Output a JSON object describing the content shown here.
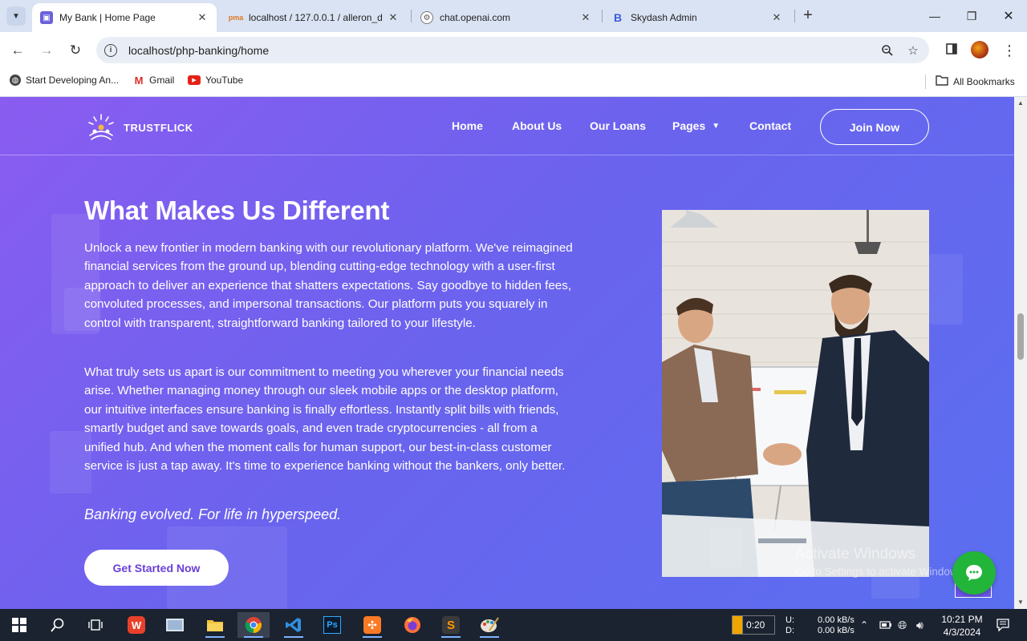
{
  "browser": {
    "tabs": [
      {
        "title": "My Bank | Home Page",
        "favicon": "bank-favicon",
        "active": true
      },
      {
        "title": "localhost / 127.0.0.1 / alleron_d",
        "favicon": "phpmyadmin-favicon",
        "active": false
      },
      {
        "title": "chat.openai.com",
        "favicon": "openai-favicon",
        "active": false
      },
      {
        "title": "Skydash Admin",
        "favicon": "skydash-favicon",
        "active": false
      }
    ],
    "url": "localhost/php-banking/home",
    "bookmarks": [
      {
        "label": "Start Developing An...",
        "icon": "globe-icon"
      },
      {
        "label": "Gmail",
        "icon": "gmail-icon"
      },
      {
        "label": "YouTube",
        "icon": "youtube-icon"
      }
    ],
    "all_bookmarks": "All Bookmarks"
  },
  "site": {
    "brand": "TRUSTFLICK",
    "nav": [
      {
        "label": "Home"
      },
      {
        "label": "About Us"
      },
      {
        "label": "Our Loans"
      },
      {
        "label": "Pages",
        "has_dropdown": true
      },
      {
        "label": "Contact"
      }
    ],
    "join_label": "Join Now"
  },
  "hero": {
    "title": "What Makes Us Different",
    "paragraph1": "Unlock a new frontier in modern banking with our revolutionary platform. We've reimagined financial services from the ground up, blending cutting-edge technology with a user-first approach to deliver an experience that shatters expectations. Say goodbye to hidden fees, convoluted processes, and impersonal transactions. Our platform puts you squarely in control with transparent, straightforward banking tailored to your lifestyle.",
    "paragraph2": "What truly sets us apart is our commitment to meeting you wherever your financial needs arise. Whether managing money through our sleek mobile apps or the desktop platform, our intuitive interfaces ensure banking is finally effortless. Instantly split bills with friends, smartly budget and save towards goals, and even trade cryptocurrencies - all from a unified hub. And when the moment calls for human support, our best-in-class customer service is just a tap away. It's time to experience banking without the bankers, only better.",
    "tagline": "Banking evolved. For life in hyperspeed.",
    "cta_label": "Get Started Now"
  },
  "watermark": {
    "line1": "Activate Windows",
    "line2": "Go to Settings to activate Windows."
  },
  "taskbar": {
    "apps": [
      "start-icon",
      "search-icon",
      "task-view-icon",
      "wps-icon",
      "remote-desktop-icon",
      "file-explorer-icon",
      "chrome-icon",
      "vscode-icon",
      "photoshop-icon",
      "xampp-icon",
      "firefox-icon",
      "sublime-icon",
      "paint-icon"
    ],
    "battery_time": "0:20",
    "upload_label": "U:",
    "download_label": "D:",
    "upload_speed": "0.00 kB/s",
    "download_speed": "0.00 kB/s",
    "time": "10:21 PM",
    "date": "4/3/2024"
  },
  "colors": {
    "accent_purple": "#8a5cf0",
    "accent_blue": "#5a6ff0",
    "chat_green": "#23b43a",
    "cta_text": "#6a3fd8"
  }
}
